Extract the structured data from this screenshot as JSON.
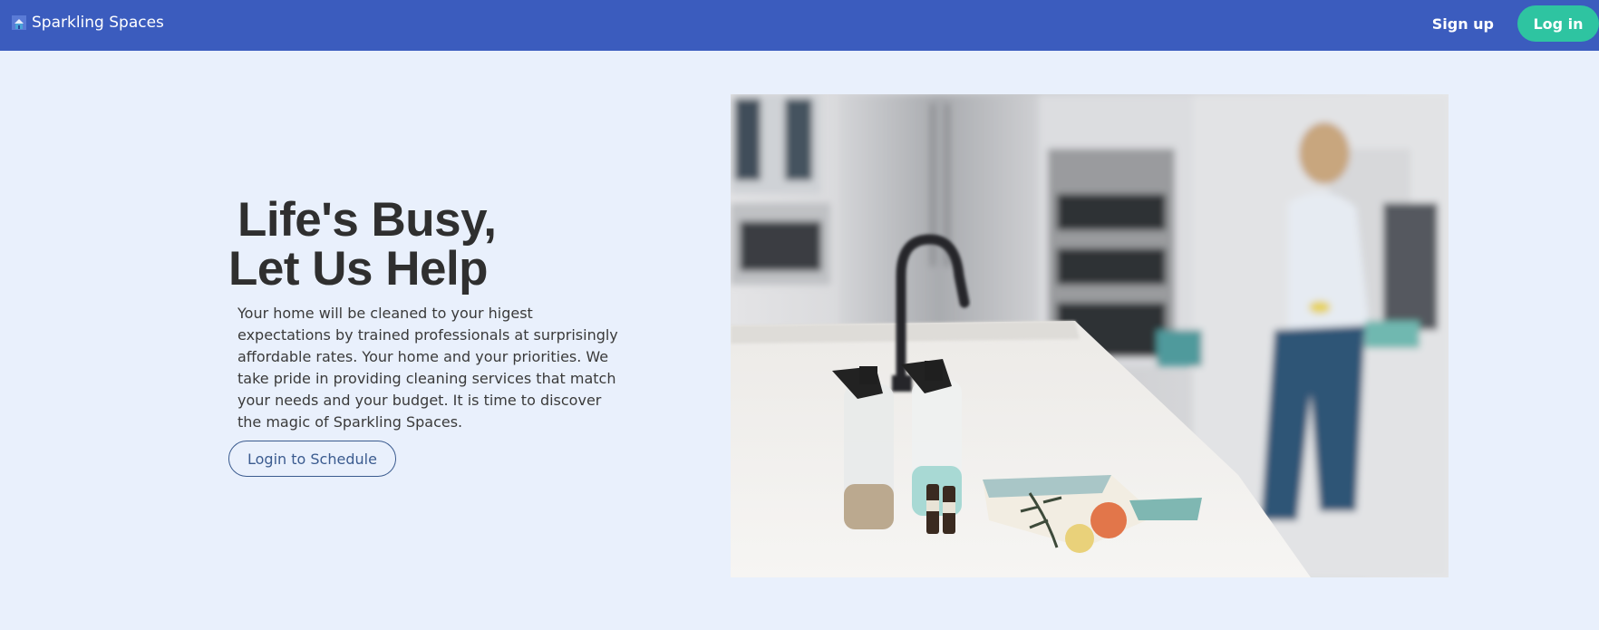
{
  "navbar": {
    "brand_name": "Sparkling Spaces",
    "brand_icon": "house-icon",
    "signup_label": "Sign up",
    "login_label": "Log in"
  },
  "hero": {
    "title_line1": "Life's Busy,",
    "title_line2": "Let Us Help",
    "description": "Your home will be cleaned to your higest expectations by trained professionals at surprisingly affordable rates. Your home and your priorities. We take pride in providing cleaning services that match your needs and your budget. It is time to discover the magic of Sparkling Spaces.",
    "cta_label": "Login to Schedule"
  },
  "colors": {
    "navbar_bg": "#3b5cbe",
    "page_bg": "#e9f0fc",
    "login_button_bg": "#2ec4a1",
    "cta_border": "#3b5b8f"
  }
}
